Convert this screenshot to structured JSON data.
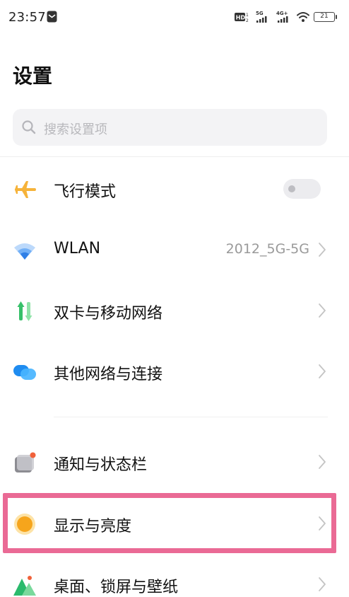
{
  "status_bar": {
    "time": "23:57",
    "hd_label": "HD",
    "network_5g": "5G",
    "network_4g": "4G+",
    "battery": "21"
  },
  "header": {
    "title": "设置"
  },
  "search": {
    "placeholder": "搜索设置项"
  },
  "settings": {
    "airplane": {
      "label": "飞行模式",
      "icon": "airplane-icon",
      "toggle_on": false
    },
    "wlan": {
      "label": "WLAN",
      "value": "2012_5G-5G",
      "icon": "wifi-icon"
    },
    "dual_sim": {
      "label": "双卡与移动网络",
      "icon": "mobile-data-icon"
    },
    "other_networks": {
      "label": "其他网络与连接",
      "icon": "connections-icon"
    },
    "notifications": {
      "label": "通知与状态栏",
      "icon": "notification-icon"
    },
    "display": {
      "label": "显示与亮度",
      "icon": "brightness-icon",
      "highlighted": true
    },
    "wallpaper": {
      "label": "桌面、锁屏与壁纸",
      "icon": "wallpaper-icon"
    }
  },
  "colors": {
    "highlight": "#ea6a95",
    "airplane": "#f6b33a",
    "wifi": "#3a8ef0",
    "mobile_up": "#3cc46a",
    "brightness": "#f6a51c"
  }
}
